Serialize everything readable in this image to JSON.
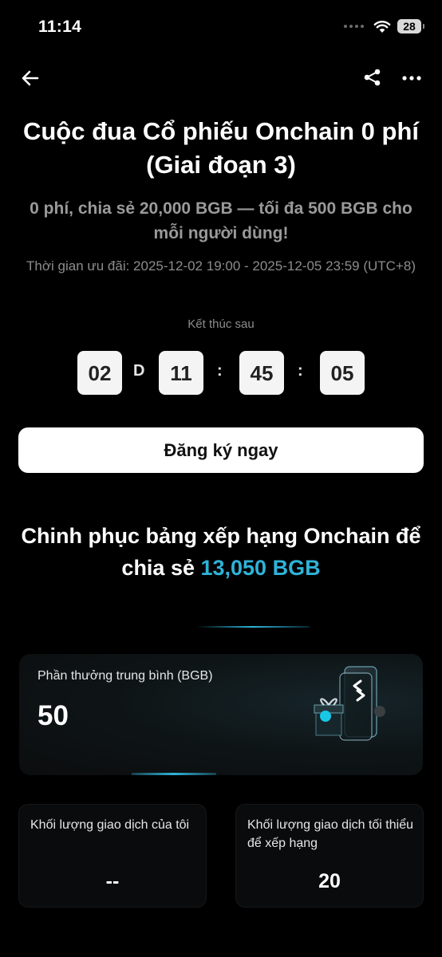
{
  "status_bar": {
    "time": "11:14",
    "battery": "28"
  },
  "hero": {
    "title": "Cuộc đua Cổ phiếu Onchain 0 phí (Giai đoạn 3)",
    "subtitle": "0 phí, chia sẻ 20,000 BGB — tối đa 500 BGB cho mỗi người dùng!",
    "period": "Thời gian ưu đãi: 2025-12-02 19:00 - 2025-12-05 23:59 (UTC+8)"
  },
  "countdown": {
    "label": "Kết thúc sau",
    "days": "02",
    "days_unit": "D",
    "hours": "11",
    "minutes": "45",
    "seconds": "05",
    "separator": ":"
  },
  "register_button": "Đăng ký ngay",
  "leaderboard": {
    "title_prefix": "Chinh phục bảng xếp hạng Onchain để chia sẻ ",
    "title_amount": "13,050 BGB",
    "accent_color": "#2fb3d9"
  },
  "average_reward": {
    "label": "Phần thưởng trung bình (BGB)",
    "value": "50"
  },
  "my_volume": {
    "label": "Khối lượng giao dịch của tôi",
    "value": "--"
  },
  "min_volume": {
    "label": "Khối lượng giao dịch tối thiểu để xếp hạng",
    "value": "20"
  }
}
